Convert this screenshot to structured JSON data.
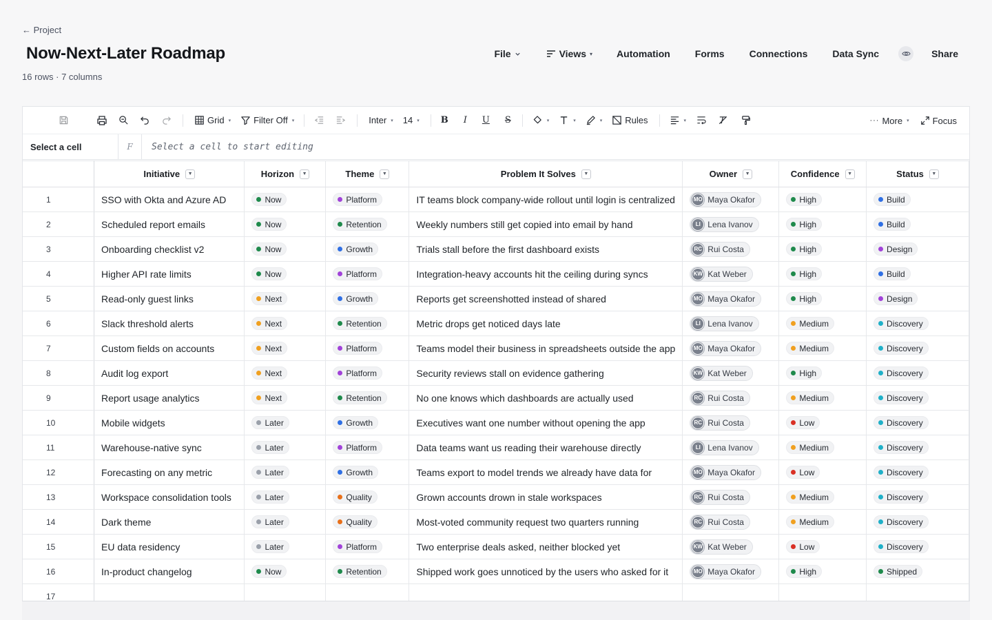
{
  "header": {
    "back_label": "← Project",
    "title": "Now-Next-Later Roadmap",
    "meta": "16 rows · 7 columns"
  },
  "topnav": {
    "file": "File",
    "views": "Views",
    "automation": "Automation",
    "forms": "Forms",
    "connections": "Connections",
    "data_sync": "Data Sync",
    "share": "Share"
  },
  "toolbar": {
    "grid": "Grid",
    "filter": "Filter Off",
    "font": "Inter",
    "font_size": "14",
    "bold": "B",
    "italic": "I",
    "underline": "U",
    "strike": "S",
    "rules": "Rules",
    "more": "More",
    "focus": "Focus"
  },
  "formula_bar": {
    "cell_ref": "Select a cell",
    "fx": "F",
    "placeholder": "Select a cell to start editing"
  },
  "columns": [
    "Initiative",
    "Horizon",
    "Theme",
    "Problem It Solves",
    "Owner",
    "Confidence",
    "Status"
  ],
  "colors": {
    "now": "#1f8a4c",
    "next": "#f0a020",
    "later": "#9aa0aa",
    "platform": "#a142d9",
    "retention": "#1f8a4c",
    "growth": "#2f6fe4",
    "quality": "#e8701a",
    "high": "#1f8a4c",
    "medium": "#f0a020",
    "low": "#d93025",
    "build": "#2f6fe4",
    "design": "#a142d9",
    "discovery": "#1fb0c8",
    "shipped": "#1f8a4c"
  },
  "rows": [
    {
      "num": "1",
      "initiative": "SSO with Okta and Azure AD",
      "horizon": "Now",
      "theme": "Platform",
      "problem": "IT teams block company-wide rollout until login is centralized",
      "owner": "Maya Okafor",
      "owner_initials": "MO",
      "confidence": "High",
      "status": "Build"
    },
    {
      "num": "2",
      "initiative": "Scheduled report emails",
      "horizon": "Now",
      "theme": "Retention",
      "problem": "Weekly numbers still get copied into email by hand",
      "owner": "Lena Ivanov",
      "owner_initials": "LI",
      "confidence": "High",
      "status": "Build"
    },
    {
      "num": "3",
      "initiative": "Onboarding checklist v2",
      "horizon": "Now",
      "theme": "Growth",
      "problem": "Trials stall before the first dashboard exists",
      "owner": "Rui Costa",
      "owner_initials": "RC",
      "confidence": "High",
      "status": "Design"
    },
    {
      "num": "4",
      "initiative": "Higher API rate limits",
      "horizon": "Now",
      "theme": "Platform",
      "problem": "Integration-heavy accounts hit the ceiling during syncs",
      "owner": "Kat Weber",
      "owner_initials": "KW",
      "confidence": "High",
      "status": "Build"
    },
    {
      "num": "5",
      "initiative": "Read-only guest links",
      "horizon": "Next",
      "theme": "Growth",
      "problem": "Reports get screenshotted instead of shared",
      "owner": "Maya Okafor",
      "owner_initials": "MO",
      "confidence": "High",
      "status": "Design"
    },
    {
      "num": "6",
      "initiative": "Slack threshold alerts",
      "horizon": "Next",
      "theme": "Retention",
      "problem": "Metric drops get noticed days late",
      "owner": "Lena Ivanov",
      "owner_initials": "LI",
      "confidence": "Medium",
      "status": "Discovery"
    },
    {
      "num": "7",
      "initiative": "Custom fields on accounts",
      "horizon": "Next",
      "theme": "Platform",
      "problem": "Teams model their business in spreadsheets outside the app",
      "owner": "Maya Okafor",
      "owner_initials": "MO",
      "confidence": "Medium",
      "status": "Discovery"
    },
    {
      "num": "8",
      "initiative": "Audit log export",
      "horizon": "Next",
      "theme": "Platform",
      "problem": "Security reviews stall on evidence gathering",
      "owner": "Kat Weber",
      "owner_initials": "KW",
      "confidence": "High",
      "status": "Discovery"
    },
    {
      "num": "9",
      "initiative": "Report usage analytics",
      "horizon": "Next",
      "theme": "Retention",
      "problem": "No one knows which dashboards are actually used",
      "owner": "Rui Costa",
      "owner_initials": "RC",
      "confidence": "Medium",
      "status": "Discovery"
    },
    {
      "num": "10",
      "initiative": "Mobile widgets",
      "horizon": "Later",
      "theme": "Growth",
      "problem": "Executives want one number without opening the app",
      "owner": "Rui Costa",
      "owner_initials": "RC",
      "confidence": "Low",
      "status": "Discovery"
    },
    {
      "num": "11",
      "initiative": "Warehouse-native sync",
      "horizon": "Later",
      "theme": "Platform",
      "problem": "Data teams want us reading their warehouse directly",
      "owner": "Lena Ivanov",
      "owner_initials": "LI",
      "confidence": "Medium",
      "status": "Discovery"
    },
    {
      "num": "12",
      "initiative": "Forecasting on any metric",
      "horizon": "Later",
      "theme": "Growth",
      "problem": "Teams export to model trends we already have data for",
      "owner": "Maya Okafor",
      "owner_initials": "MO",
      "confidence": "Low",
      "status": "Discovery"
    },
    {
      "num": "13",
      "initiative": "Workspace consolidation tools",
      "horizon": "Later",
      "theme": "Quality",
      "problem": "Grown accounts drown in stale workspaces",
      "owner": "Rui Costa",
      "owner_initials": "RC",
      "confidence": "Medium",
      "status": "Discovery"
    },
    {
      "num": "14",
      "initiative": "Dark theme",
      "horizon": "Later",
      "theme": "Quality",
      "problem": "Most-voted community request two quarters running",
      "owner": "Rui Costa",
      "owner_initials": "RC",
      "confidence": "Medium",
      "status": "Discovery"
    },
    {
      "num": "15",
      "initiative": "EU data residency",
      "horizon": "Later",
      "theme": "Platform",
      "problem": "Two enterprise deals asked, neither blocked yet",
      "owner": "Kat Weber",
      "owner_initials": "KW",
      "confidence": "Low",
      "status": "Discovery"
    },
    {
      "num": "16",
      "initiative": "In-product changelog",
      "horizon": "Now",
      "theme": "Retention",
      "problem": "Shipped work goes unnoticed by the users who asked for it",
      "owner": "Maya Okafor",
      "owner_initials": "MO",
      "confidence": "High",
      "status": "Shipped"
    }
  ],
  "empty_row_num": "17"
}
